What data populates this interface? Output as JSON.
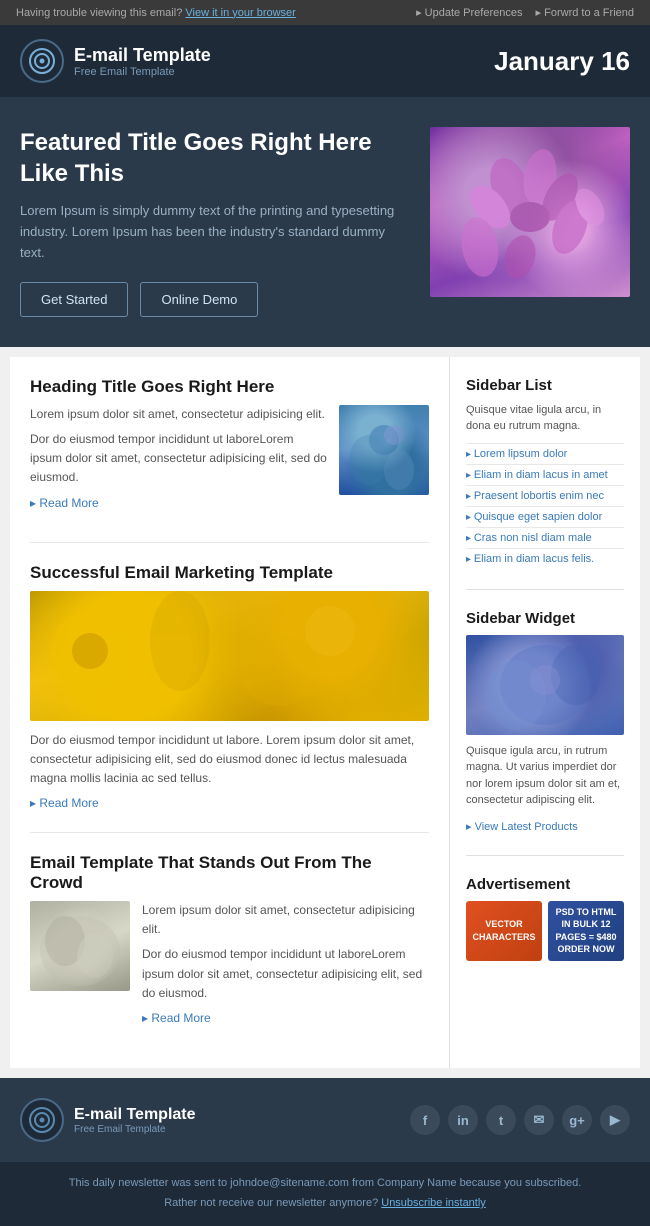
{
  "topbar": {
    "trouble_text": "Having trouble viewing this email?",
    "view_link": "View it in your browser",
    "update_prefs": "Update Preferences",
    "forward": "Forwrd to a Friend"
  },
  "header": {
    "logo_alt": "E-mail Template logo",
    "brand_name": "E-mail Template",
    "brand_sub": "Free Email Template",
    "date": "January 16"
  },
  "hero": {
    "title": "Featured Title Goes Right Here Like This",
    "body": "Lorem Ipsum is simply dummy text of the printing and typesetting industry. Lorem Ipsum has been the industry's standard dummy text.",
    "btn1": "Get Started",
    "btn2": "Online Demo"
  },
  "main_article": {
    "title": "Heading Title Goes Right Here",
    "para1": "Lorem ipsum dolor sit amet, consectetur adipisicing elit.",
    "para2": "Dor do eiusmod tempor incididunt ut laboreLorem ipsum dolor sit amet, consectetur adipisicing elit, sed do eiusmod.",
    "read_more": "Read More"
  },
  "article2": {
    "title": "Successful Email Marketing Template",
    "body": "Dor do eiusmod tempor incididunt ut labore. Lorem ipsum dolor sit amet, consectetur adipisicing elit, sed do eiusmod donec id lectus malesuada magna mollis lacinia ac sed tellus.",
    "read_more": "Read More"
  },
  "article3": {
    "title": "Email Template That Stands Out From The Crowd",
    "intro": "Lorem ipsum dolor sit amet, consectetur adipisicing elit.",
    "body": "Dor do eiusmod tempor incididunt ut laboreLorem ipsum dolor sit amet, consectetur adipisicing elit, sed do eiusmod.",
    "read_more": "Read More"
  },
  "sidebar": {
    "list_title": "Sidebar List",
    "list_desc": "Quisque vitae ligula arcu, in dona eu rutrum magna.",
    "list_items": [
      "Lorem lipsum dolor",
      "Eliam in diam lacus in amet",
      "Praesent lobortis enim nec",
      "Quisque eget sapien dolor",
      "Cras non nisl diam male",
      "Eliam in diam lacus felis."
    ],
    "widget_title": "Sidebar Widget",
    "widget_body": "Quisque igula arcu, in rutrum magna. Ut varius imperdiet dor nor lorem ipsum dolor sit am et, consectetur adipiscing elit.",
    "widget_link": "View Latest Products",
    "ad_title": "Advertisement",
    "ad1_text": "VECTOR CHARACTERS",
    "ad2_text": "PSD TO HTML IN BULK\n12 PAGES = $480 ORDER NOW"
  },
  "footer": {
    "brand_name": "E-mail Template",
    "brand_sub": "Free Email Template",
    "social": [
      "f",
      "in",
      "t",
      "✉",
      "g+",
      "▶"
    ],
    "bottom1": "This daily newsletter was sent to johndoe@sitename.com from Company Name because you subscribed.",
    "bottom2": "Rather not receive our newsletter anymore?",
    "unsubscribe": "Unsubscribe instantly"
  }
}
